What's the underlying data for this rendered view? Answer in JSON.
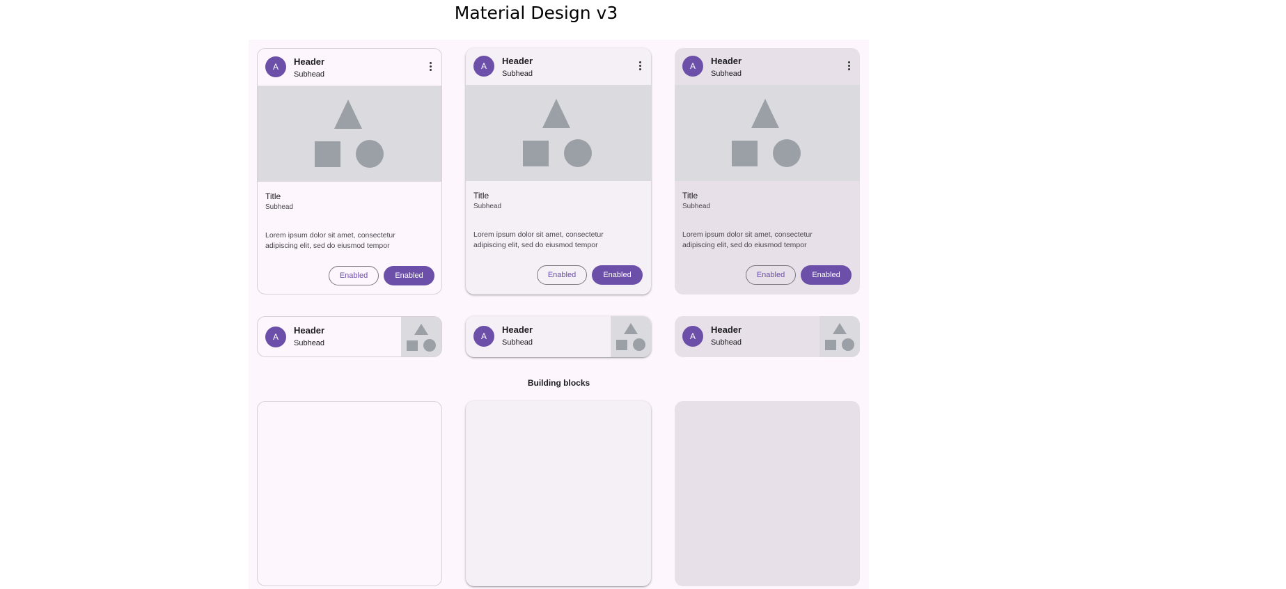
{
  "page": {
    "title": "Material Design v3"
  },
  "media_cards": [
    {
      "avatar": "A",
      "header": "Header",
      "subhead": "Subhead",
      "title": "Title",
      "card_subhead": "Subhead",
      "body": "Lorem ipsum dolor sit amet, consectetur adipiscing elit, sed do eiusmod tempor",
      "outline_button": "Enabled",
      "filled_button": "Enabled"
    },
    {
      "avatar": "A",
      "header": "Header",
      "subhead": "Subhead",
      "title": "Title",
      "card_subhead": "Subhead",
      "body": "Lorem ipsum dolor sit amet, consectetur adipiscing elit, sed do eiusmod tempor",
      "outline_button": "Enabled",
      "filled_button": "Enabled"
    },
    {
      "avatar": "A",
      "header": "Header",
      "subhead": "Subhead",
      "title": "Title",
      "card_subhead": "Subhead",
      "body": "Lorem ipsum dolor sit amet, consectetur adipiscing elit, sed do eiusmod tempor",
      "outline_button": "Enabled",
      "filled_button": "Enabled"
    }
  ],
  "list_cards": [
    {
      "avatar": "A",
      "header": "Header",
      "subhead": "Subhead"
    },
    {
      "avatar": "A",
      "header": "Header",
      "subhead": "Subhead"
    },
    {
      "avatar": "A",
      "header": "Header",
      "subhead": "Subhead"
    }
  ],
  "building_blocks": {
    "label": "Building blocks"
  },
  "colors": {
    "primary": "#6b4fa8",
    "surface": "#fdf7fd",
    "outlined_card": "#fdf7fd",
    "elevated_card": "#f5eff6",
    "filled_card": "#e7e0e8",
    "media_bg": "#dbdbdf",
    "shape": "#9aa0a6"
  },
  "icons": [
    "more-vert-icon",
    "triangle-shape",
    "square-shape",
    "circle-shape"
  ]
}
